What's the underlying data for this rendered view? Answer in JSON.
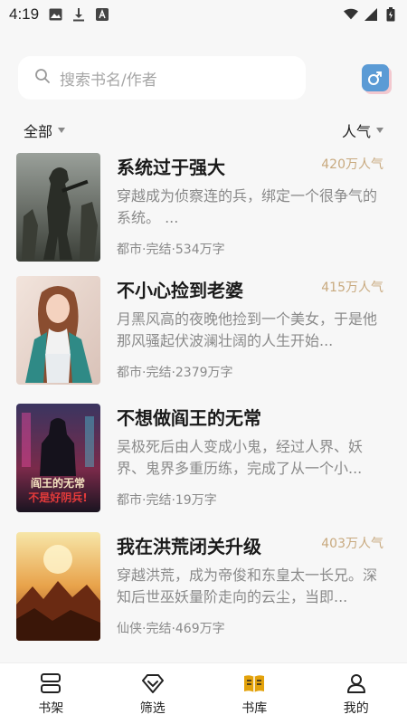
{
  "status_bar": {
    "time": "4:19"
  },
  "search": {
    "placeholder": "搜索书名/作者"
  },
  "filters": {
    "left_label": "全部",
    "right_label": "人气"
  },
  "books": [
    {
      "title": "系统过于强大",
      "popularity": "420万人气",
      "description": "穿越成为侦察连的兵，绑定一个很争气的系统。 ...",
      "meta": "都市·完结·534万字"
    },
    {
      "title": "不小心捡到老婆",
      "popularity": "415万人气",
      "description": "月黑风高的夜晚他捡到一个美女，于是他那风骚起伏波澜壮阔的人生开始...",
      "meta": "都市·完结·2379万字"
    },
    {
      "title": "不想做阎王的无常",
      "popularity": "",
      "description": "吴极死后由人变成小鬼，经过人界、妖界、鬼界多重历练，完成了从一个小...",
      "meta": "都市·完结·19万字",
      "cover_text": "阎王的无常 不是好阴兵!"
    },
    {
      "title": "我在洪荒闭关升级",
      "popularity": "403万人气",
      "description": "穿越洪荒，成为帝俊和东皇太一长兄。深知后世巫妖量阶走向的云尘，当即...",
      "meta": "仙侠·完结·469万字"
    }
  ],
  "tabbar": [
    {
      "label": "书架",
      "icon": "bookshelf-icon"
    },
    {
      "label": "筛选",
      "icon": "filter-diamond-icon"
    },
    {
      "label": "书库",
      "icon": "library-book-icon"
    },
    {
      "label": "我的",
      "icon": "user-icon"
    }
  ],
  "colors": {
    "accent_gold": "#c8a97e",
    "library_icon": "#e3a20b",
    "gender_button": "#5b9bd5"
  }
}
